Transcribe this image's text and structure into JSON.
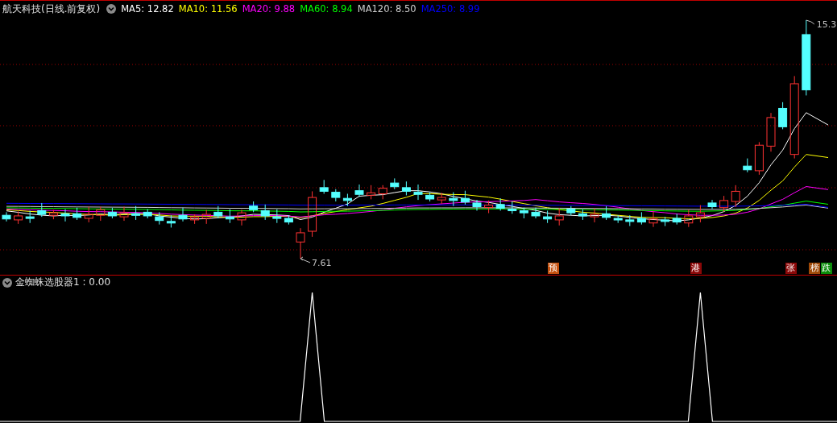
{
  "header": {
    "title": "航天科技(日线.前复权)",
    "legend": [
      {
        "label": "MA5: 12.82",
        "color": "#ffffff"
      },
      {
        "label": "MA10: 11.56",
        "color": "#ffff00"
      },
      {
        "label": "MA20: 9.88",
        "color": "#ff00ff"
      },
      {
        "label": "MA60: 8.94",
        "color": "#00ff00"
      },
      {
        "label": "MA120: 8.50",
        "color": "#d0d0d0"
      },
      {
        "label": "MA250: 8.99",
        "color": "#0000ff"
      }
    ]
  },
  "main_chart": {
    "high_label": "15.3",
    "low_label": "7.61",
    "markers": [
      {
        "text": "预",
        "color": "#c4500e"
      },
      {
        "text": "港",
        "color": "#8c0808"
      },
      {
        "text": "张",
        "color": "#8c0808"
      },
      {
        "text": "榜",
        "color": "#a04a08"
      },
      {
        "text": "跌",
        "color": "#0a8c0a"
      }
    ]
  },
  "indicator_pane": {
    "title": "金蜘蛛选股器1 : 0.00"
  }
}
